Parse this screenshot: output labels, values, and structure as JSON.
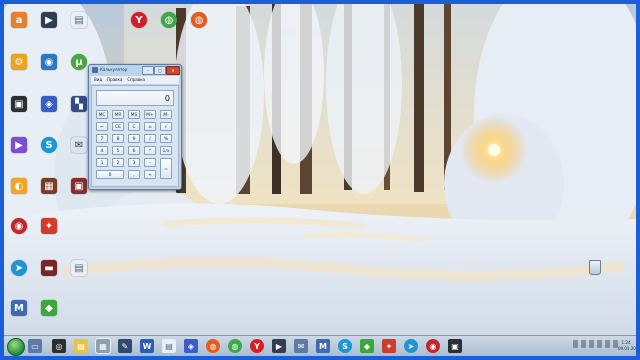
{
  "desktop": {
    "icons": [
      {
        "glyph": "a",
        "color": "#e8812a",
        "label": "",
        "icon": "app-icon"
      },
      {
        "glyph": "▶",
        "color": "#2f3d55",
        "label": "",
        "icon": "media-player-icon"
      },
      {
        "glyph": "▤",
        "color": "#e7eef6",
        "label": "",
        "icon": "document-icon"
      },
      {
        "glyph": "⚙",
        "color": "#f0a21c",
        "label": "",
        "icon": "settings-icon"
      },
      {
        "glyph": "◉",
        "color": "#2b78c7",
        "label": "",
        "icon": "network-icon"
      },
      {
        "glyph": "µ",
        "color": "#48a83a",
        "label": "",
        "icon": "utorrent-icon"
      },
      {
        "glyph": "▣",
        "color": "#2a2f33",
        "label": "",
        "icon": "screen-capture-icon"
      },
      {
        "glyph": "◈",
        "color": "#3a5ec7",
        "label": "",
        "icon": "browser-icon"
      },
      {
        "glyph": "▚",
        "color": "#324b8a",
        "label": "",
        "icon": "network-adapter-icon"
      },
      {
        "glyph": "▶",
        "color": "#7b4ed8",
        "label": "",
        "icon": "visual-studio-icon"
      },
      {
        "glyph": "S",
        "color": "#1a97d8",
        "label": "",
        "icon": "skype-icon"
      },
      {
        "glyph": "✉",
        "color": "#d9e4ef",
        "label": "",
        "icon": "mail-icon"
      },
      {
        "glyph": "◐",
        "color": "#f3a522",
        "label": "",
        "icon": "photo-icon"
      },
      {
        "glyph": "▦",
        "color": "#7c3a2b",
        "label": "",
        "icon": "game-icon"
      },
      {
        "glyph": "▣",
        "color": "#8a2c2c",
        "label": "",
        "icon": "film-icon"
      },
      {
        "glyph": "◉",
        "color": "#c4262c",
        "label": "",
        "icon": "record-icon"
      },
      {
        "glyph": "✦",
        "color": "#d23a2a",
        "label": "",
        "icon": "antivirus-icon"
      },
      {
        "glyph": "➤",
        "color": "#1f95d4",
        "label": "",
        "icon": "telegram-icon"
      },
      {
        "glyph": "▬",
        "color": "#7b2327",
        "label": "",
        "icon": "bar-icon"
      },
      {
        "glyph": "▤",
        "color": "#e7eef6",
        "label": "",
        "icon": "text-file-icon"
      },
      {
        "glyph": "M",
        "color": "#3c6bb4",
        "label": "",
        "icon": "mail-client-icon"
      },
      {
        "glyph": "◆",
        "color": "#3aa83a",
        "label": "",
        "icon": "shape-icon"
      },
      {
        "glyph": "Y",
        "color": "#d61f26",
        "label": "",
        "icon": "yandex-icon"
      },
      {
        "glyph": "◍",
        "color": "#3ea84a",
        "label": "",
        "icon": "chrome-icon"
      },
      {
        "glyph": "◍",
        "color": "#e95a1d",
        "label": "",
        "icon": "firefox-icon"
      }
    ],
    "recycle_label": ""
  },
  "calculator": {
    "title": "Калькулятор",
    "menu": [
      "Вид",
      "Правка",
      "Справка"
    ],
    "display": "0",
    "keys": [
      "MC",
      "MR",
      "MS",
      "M+",
      "M-",
      "←",
      "CE",
      "C",
      "±",
      "√",
      "7",
      "8",
      "9",
      "/",
      "%",
      "4",
      "5",
      "6",
      "*",
      "1/x",
      "1",
      "2",
      "3",
      "-",
      "=",
      "0",
      ",",
      "+"
    ]
  },
  "taskbar": {
    "clock_time": "1:24",
    "clock_date": "09.01.2020",
    "items": [
      {
        "glyph": "▭",
        "color": "#5b7aa6",
        "icon": "explorer-icon"
      },
      {
        "glyph": "◎",
        "color": "#2e2e2e",
        "icon": "media-icon"
      },
      {
        "glyph": "▤",
        "color": "#e6c44a",
        "icon": "folder-icon"
      },
      {
        "glyph": "▦",
        "color": "#8f9db0",
        "icon": "calculator-icon",
        "active": true
      },
      {
        "glyph": "✎",
        "color": "#30496e",
        "icon": "pen-icon"
      },
      {
        "glyph": "W",
        "color": "#2b5eb0",
        "icon": "word-icon"
      },
      {
        "glyph": "▤",
        "color": "#e7eef6",
        "icon": "notepad-icon"
      },
      {
        "glyph": "◈",
        "color": "#3a5ec7",
        "icon": "browser-icon"
      },
      {
        "glyph": "◍",
        "color": "#e95a1d",
        "icon": "firefox-icon"
      },
      {
        "glyph": "◍",
        "color": "#3ea84a",
        "icon": "chrome-icon"
      },
      {
        "glyph": "Y",
        "color": "#d61f26",
        "icon": "yandex-icon"
      },
      {
        "glyph": "▶",
        "color": "#333d4f",
        "icon": "player-icon"
      },
      {
        "glyph": "✉",
        "color": "#5b7aa6",
        "icon": "mail-icon"
      },
      {
        "glyph": "M",
        "color": "#3c6bb4",
        "icon": "mail-client-icon"
      },
      {
        "glyph": "S",
        "color": "#1a97d8",
        "icon": "skype-icon"
      },
      {
        "glyph": "◆",
        "color": "#3aa83a",
        "icon": "shape-icon"
      },
      {
        "glyph": "✦",
        "color": "#d23a2a",
        "icon": "antivirus-icon"
      },
      {
        "glyph": "➤",
        "color": "#1f95d4",
        "icon": "telegram-icon"
      },
      {
        "glyph": "◉",
        "color": "#c4262c",
        "icon": "record-icon"
      },
      {
        "glyph": "▣",
        "color": "#2a2f33",
        "icon": "screen-capture-icon"
      }
    ]
  }
}
